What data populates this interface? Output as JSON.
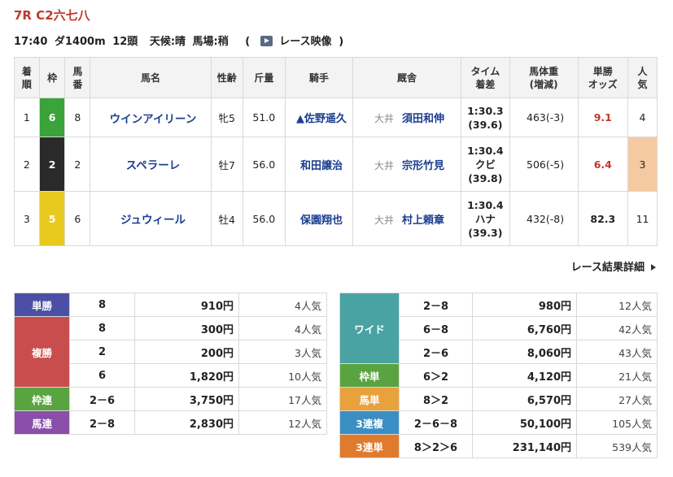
{
  "race": {
    "title": "7R C2六七八",
    "time": "17:40",
    "course": "ダ1400m",
    "runners": "12頭",
    "weather": "天候:晴",
    "track": "馬場:稍",
    "video_open": "(",
    "video_label": "レース映像",
    "video_close": ")"
  },
  "results_table": {
    "headers": {
      "order": [
        "着",
        "順"
      ],
      "frame": "枠",
      "horse_no": [
        "馬",
        "番"
      ],
      "name": "馬名",
      "sex_age": "性齢",
      "weight": "斤量",
      "jockey": "騎手",
      "trainer": "厩舎",
      "time": [
        "タイム",
        "着差"
      ],
      "body_weight": [
        "馬体重",
        "(増減)"
      ],
      "odds": [
        "単勝",
        "オッズ"
      ],
      "popularity": [
        "人",
        "気"
      ]
    },
    "rows": [
      {
        "order": "1",
        "frame": "6",
        "horse_no": "8",
        "name": "ウインアイリーン",
        "sex_age": "牝5",
        "weight": "51.0",
        "jockey": "▲佐野遥久",
        "trainer_loc": "大井",
        "trainer": "須田和伸",
        "time": "1:30.3",
        "margin": "",
        "sub": "(39.6)",
        "body_weight": "463(-3)",
        "odds": "9.1",
        "popularity": "4"
      },
      {
        "order": "2",
        "frame": "2",
        "horse_no": "2",
        "name": "スペラーレ",
        "sex_age": "牡7",
        "weight": "56.0",
        "jockey": "和田譲治",
        "trainer_loc": "大井",
        "trainer": "宗形竹見",
        "time": "1:30.4",
        "margin": "クビ",
        "sub": "(39.8)",
        "body_weight": "506(-5)",
        "odds": "6.4",
        "popularity": "3"
      },
      {
        "order": "3",
        "frame": "5",
        "horse_no": "6",
        "name": "ジュウィール",
        "sex_age": "牡4",
        "weight": "56.0",
        "jockey": "保園翔也",
        "trainer_loc": "大井",
        "trainer": "村上頼章",
        "time": "1:30.4",
        "margin": "ハナ",
        "sub": "(39.3)",
        "body_weight": "432(-8)",
        "odds": "82.3",
        "popularity": "11"
      }
    ],
    "frame_colors": {
      "6": "#3aa33a",
      "2": "#2a2a2a",
      "5": "#e8c91e"
    }
  },
  "detail_link": "レース結果詳細",
  "payouts_left": {
    "tansho": {
      "label": "単勝",
      "rows": [
        {
          "combo": "8",
          "amount": "910円",
          "pop": "4人気"
        }
      ]
    },
    "fukusho": {
      "label": "複勝",
      "rows": [
        {
          "combo": "8",
          "amount": "300円",
          "pop": "4人気"
        },
        {
          "combo": "2",
          "amount": "200円",
          "pop": "3人気"
        },
        {
          "combo": "6",
          "amount": "1,820円",
          "pop": "10人気"
        }
      ]
    },
    "wakuren": {
      "label": "枠連",
      "rows": [
        {
          "combo": "2－6",
          "amount": "3,750円",
          "pop": "17人気"
        }
      ]
    },
    "umaren": {
      "label": "馬連",
      "rows": [
        {
          "combo": "2－8",
          "amount": "2,830円",
          "pop": "12人気"
        }
      ]
    }
  },
  "payouts_right": {
    "wide": {
      "label": "ワイド",
      "rows": [
        {
          "combo": "2－8",
          "amount": "980円",
          "pop": "12人気"
        },
        {
          "combo": "6－8",
          "amount": "6,760円",
          "pop": "42人気"
        },
        {
          "combo": "2－6",
          "amount": "8,060円",
          "pop": "43人気"
        }
      ]
    },
    "wakutan": {
      "label": "枠単",
      "rows": [
        {
          "combo": "6＞2",
          "amount": "4,120円",
          "pop": "21人気"
        }
      ]
    },
    "umatan": {
      "label": "馬単",
      "rows": [
        {
          "combo": "8＞2",
          "amount": "6,570円",
          "pop": "27人気"
        }
      ]
    },
    "sanrenpuku": {
      "label": "3連複",
      "rows": [
        {
          "combo": "2－6－8",
          "amount": "50,100円",
          "pop": "105人気"
        }
      ]
    },
    "sanrentan": {
      "label": "3連単",
      "rows": [
        {
          "combo": "8＞2＞6",
          "amount": "231,140円",
          "pop": "539人気"
        }
      ]
    }
  },
  "colors": {
    "title_red": "#c0392b",
    "link_blue": "#1a3d8f",
    "tansho": "#4b4fa5",
    "fukusho": "#c94d4d",
    "wakuren": "#5aa341",
    "umaren": "#8a4fa8",
    "wide": "#4aa3a3",
    "wakutan": "#5aa341",
    "umatan": "#e8a23c",
    "sanrenpuku": "#3b8ec4",
    "sanrentan": "#e07b2e",
    "popularity_highlight": "#f5c9a2"
  }
}
